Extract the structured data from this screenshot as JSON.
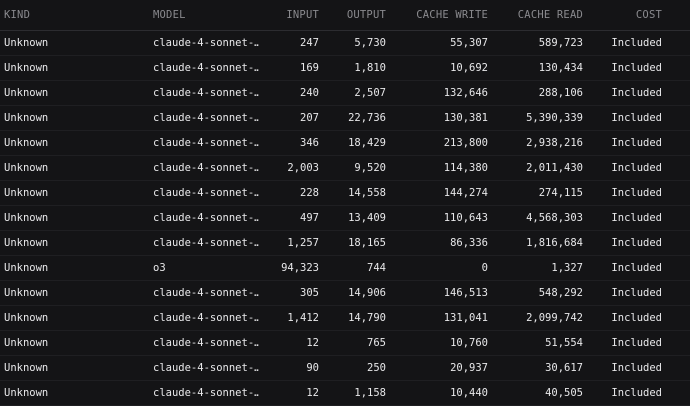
{
  "columns": {
    "kind": "KIND",
    "model": "MODEL",
    "input": "INPUT",
    "output": "OUTPUT",
    "cache_write": "CACHE WRITE",
    "cache_read": "CACHE READ",
    "cost": "COST"
  },
  "rows": [
    {
      "kind": "Unknown",
      "model": "claude-4-sonnet-…",
      "input": "247",
      "output": "5,730",
      "cache_write": "55,307",
      "cache_read": "589,723",
      "cost": "Included"
    },
    {
      "kind": "Unknown",
      "model": "claude-4-sonnet-…",
      "input": "169",
      "output": "1,810",
      "cache_write": "10,692",
      "cache_read": "130,434",
      "cost": "Included"
    },
    {
      "kind": "Unknown",
      "model": "claude-4-sonnet-…",
      "input": "240",
      "output": "2,507",
      "cache_write": "132,646",
      "cache_read": "288,106",
      "cost": "Included"
    },
    {
      "kind": "Unknown",
      "model": "claude-4-sonnet-…",
      "input": "207",
      "output": "22,736",
      "cache_write": "130,381",
      "cache_read": "5,390,339",
      "cost": "Included"
    },
    {
      "kind": "Unknown",
      "model": "claude-4-sonnet-…",
      "input": "346",
      "output": "18,429",
      "cache_write": "213,800",
      "cache_read": "2,938,216",
      "cost": "Included"
    },
    {
      "kind": "Unknown",
      "model": "claude-4-sonnet-…",
      "input": "2,003",
      "output": "9,520",
      "cache_write": "114,380",
      "cache_read": "2,011,430",
      "cost": "Included"
    },
    {
      "kind": "Unknown",
      "model": "claude-4-sonnet-…",
      "input": "228",
      "output": "14,558",
      "cache_write": "144,274",
      "cache_read": "274,115",
      "cost": "Included"
    },
    {
      "kind": "Unknown",
      "model": "claude-4-sonnet-…",
      "input": "497",
      "output": "13,409",
      "cache_write": "110,643",
      "cache_read": "4,568,303",
      "cost": "Included"
    },
    {
      "kind": "Unknown",
      "model": "claude-4-sonnet-…",
      "input": "1,257",
      "output": "18,165",
      "cache_write": "86,336",
      "cache_read": "1,816,684",
      "cost": "Included"
    },
    {
      "kind": "Unknown",
      "model": "o3",
      "input": "94,323",
      "output": "744",
      "cache_write": "0",
      "cache_read": "1,327",
      "cost": "Included"
    },
    {
      "kind": "Unknown",
      "model": "claude-4-sonnet-…",
      "input": "305",
      "output": "14,906",
      "cache_write": "146,513",
      "cache_read": "548,292",
      "cost": "Included"
    },
    {
      "kind": "Unknown",
      "model": "claude-4-sonnet-…",
      "input": "1,412",
      "output": "14,790",
      "cache_write": "131,041",
      "cache_read": "2,099,742",
      "cost": "Included"
    },
    {
      "kind": "Unknown",
      "model": "claude-4-sonnet-…",
      "input": "12",
      "output": "765",
      "cache_write": "10,760",
      "cache_read": "51,554",
      "cost": "Included"
    },
    {
      "kind": "Unknown",
      "model": "claude-4-sonnet-…",
      "input": "90",
      "output": "250",
      "cache_write": "20,937",
      "cache_read": "30,617",
      "cost": "Included"
    },
    {
      "kind": "Unknown",
      "model": "claude-4-sonnet-…",
      "input": "12",
      "output": "1,158",
      "cache_write": "10,440",
      "cache_read": "40,505",
      "cost": "Included"
    }
  ]
}
